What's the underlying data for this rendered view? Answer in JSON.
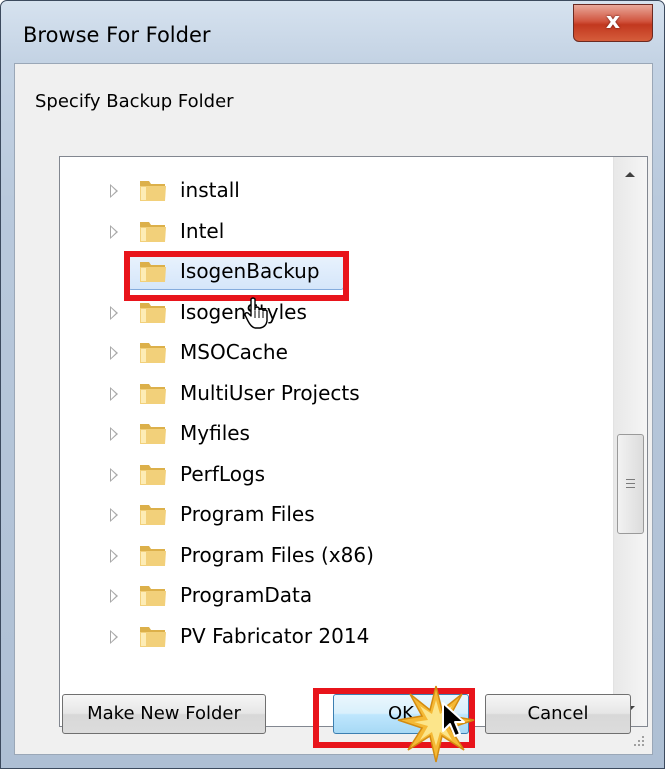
{
  "window": {
    "title": "Browse For Folder",
    "close_glyph": "x"
  },
  "dialog": {
    "instruction": "Specify Backup Folder"
  },
  "tree": {
    "items": [
      {
        "label": "install",
        "expandable": true,
        "selected": false
      },
      {
        "label": "Intel",
        "expandable": true,
        "selected": false
      },
      {
        "label": "IsogenBackup",
        "expandable": false,
        "selected": true
      },
      {
        "label": "IsogenStyles",
        "expandable": true,
        "selected": false
      },
      {
        "label": "MSOCache",
        "expandable": true,
        "selected": false
      },
      {
        "label": "MultiUser Projects",
        "expandable": true,
        "selected": false
      },
      {
        "label": "Myfiles",
        "expandable": true,
        "selected": false
      },
      {
        "label": "PerfLogs",
        "expandable": true,
        "selected": false
      },
      {
        "label": "Program Files",
        "expandable": true,
        "selected": false
      },
      {
        "label": "Program Files (x86)",
        "expandable": true,
        "selected": false
      },
      {
        "label": "ProgramData",
        "expandable": true,
        "selected": false
      },
      {
        "label": "PV Fabricator 2014",
        "expandable": true,
        "selected": false
      }
    ]
  },
  "buttons": {
    "make_new_folder": "Make New Folder",
    "ok": "OK",
    "cancel": "Cancel"
  },
  "annotations": {
    "highlight_color": "#e8141b",
    "highlighted_targets": [
      "IsogenBackup",
      "OK"
    ]
  },
  "icons": {
    "folder": "folder-icon",
    "expander": "expand-arrow-icon",
    "cursor_hand": "hand-pointer-icon",
    "cursor_arrow": "arrow-cursor-icon",
    "click_burst": "click-burst-icon"
  },
  "colors": {
    "folder": "#e8c35a",
    "selection": "#d5e6fa",
    "close_button": "#c2381f"
  }
}
